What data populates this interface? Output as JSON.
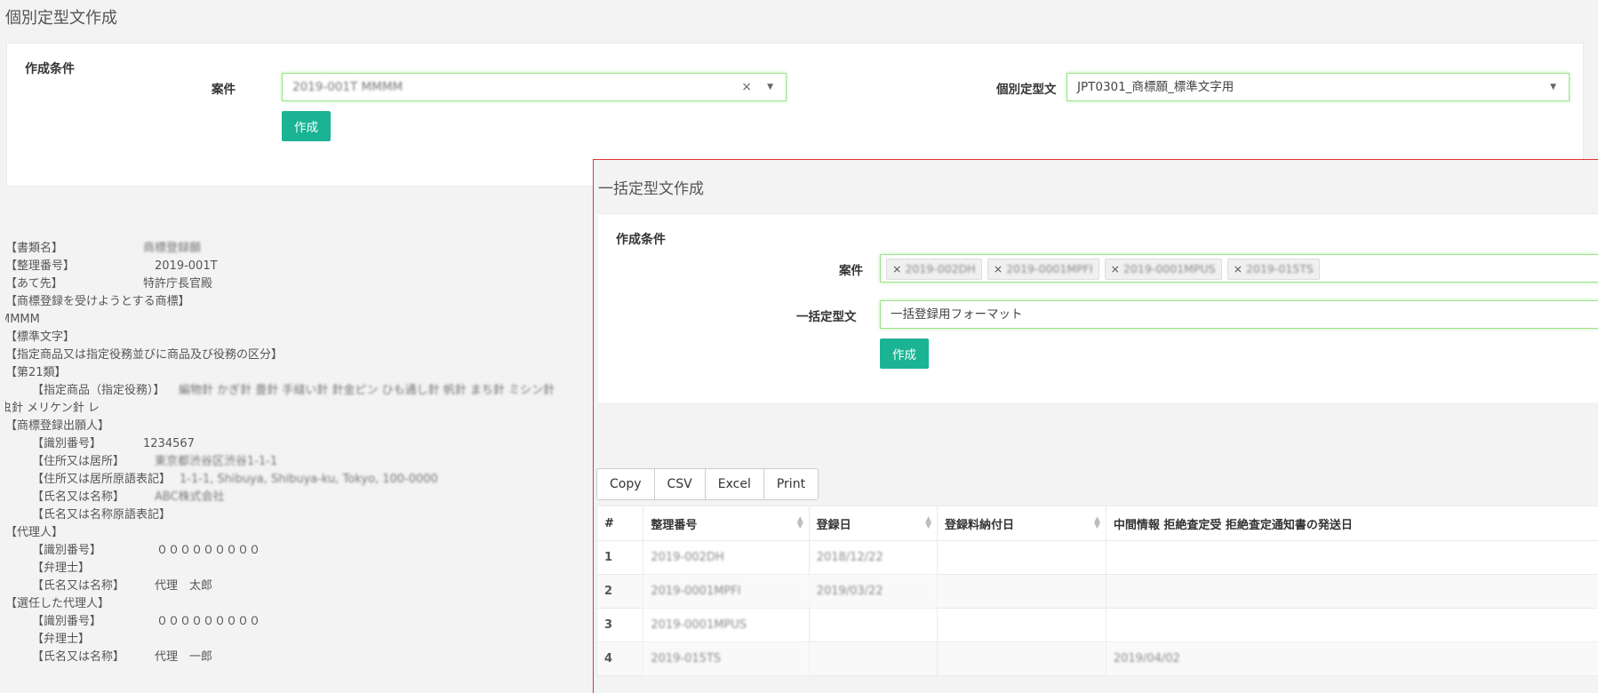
{
  "page_title": "個別定型文作成",
  "top_panel": {
    "heading": "作成条件",
    "case_label": "案件",
    "case_value": "2019-001T MMMM",
    "case_clear": "×",
    "case_arrow": "▼",
    "template_label": "個別定型文",
    "template_value": "JPT0301_商標願_標準文字用",
    "template_arrow": "▼",
    "create_button": "作成"
  },
  "document_lines": [
    {
      "key": "【書類名】",
      "val": "商標登録願",
      "blur": true,
      "indent": 0,
      "valx": 155
    },
    {
      "key": "【整理番号】",
      "val": "2019-001T",
      "blur": false,
      "indent": 0,
      "valx": 168
    },
    {
      "key": "【あて先】",
      "val": "特許庁長官殿",
      "blur": false,
      "indent": 0,
      "valx": 155
    },
    {
      "key": "【商標登録を受けようとする商標】",
      "val": "",
      "blur": false,
      "indent": 0,
      "valx": 0
    },
    {
      "key": "MMMM",
      "val": "",
      "blur": false,
      "indent": -6,
      "valx": 0
    },
    {
      "key": "【標準文字】",
      "val": "",
      "blur": false,
      "indent": 0,
      "valx": 0
    },
    {
      "key": "【指定商品又は指定役務並びに商品及び役務の区分】",
      "val": "",
      "blur": false,
      "indent": 0,
      "valx": 0
    },
    {
      "key": "【第21類】",
      "val": "",
      "blur": false,
      "indent": 0,
      "valx": 0
    },
    {
      "key": "【指定商品（指定役務）】",
      "val": "編物針 かぎ針 畳針 手縫い針 針金ピン ひも通し針 帆針 まち針 ミシン針",
      "blur": true,
      "indent": 30,
      "valx": 0
    },
    {
      "key": "虫針 メリケン針 レ",
      "val": "",
      "blur": false,
      "indent": -6,
      "valx": 0
    },
    {
      "key": "【商標登録出願人】",
      "val": "",
      "blur": false,
      "indent": 0,
      "valx": 0
    },
    {
      "key": "【識別番号】",
      "val": "1234567",
      "blur": false,
      "indent": 30,
      "valx": 155
    },
    {
      "key": "【住所又は居所】",
      "val": "東京都渋谷区渋谷1-1-1",
      "blur": true,
      "indent": 30,
      "valx": 168
    },
    {
      "key": "【住所又は居所原語表記】",
      "val": "1-1-1, Shibuya, Shibuya-ku, Tokyo, 100-0000",
      "blur": true,
      "indent": 30,
      "valx": 196
    },
    {
      "key": "【氏名又は名称】",
      "val": "ABC株式会社",
      "blur": true,
      "indent": 30,
      "valx": 168
    },
    {
      "key": "【氏名又は名称原語表記】",
      "val": "",
      "blur": false,
      "indent": 30,
      "valx": 0
    },
    {
      "key": "【代理人】",
      "val": "",
      "blur": false,
      "indent": 0,
      "valx": 0
    },
    {
      "key": "【識別番号】",
      "val": "０００００００００",
      "blur": false,
      "indent": 30,
      "valx": 170
    },
    {
      "key": "【弁理士】",
      "val": "",
      "blur": false,
      "indent": 30,
      "valx": 0
    },
    {
      "key": "【氏名又は名称】",
      "val": "代理　太郎",
      "blur": false,
      "indent": 30,
      "valx": 168
    },
    {
      "key": "【選任した代理人】",
      "val": "",
      "blur": false,
      "indent": 0,
      "valx": 0
    },
    {
      "key": "【識別番号】",
      "val": "０００００００００",
      "blur": false,
      "indent": 30,
      "valx": 170
    },
    {
      "key": "【弁理士】",
      "val": "",
      "blur": false,
      "indent": 30,
      "valx": 0
    },
    {
      "key": "【氏名又は名称】",
      "val": "代理　一郎",
      "blur": false,
      "indent": 30,
      "valx": 168
    }
  ],
  "bulk": {
    "title": "一括定型文作成",
    "heading": "作成条件",
    "case_label": "案件",
    "tags": [
      "2019-002DH",
      "2019-0001MPFI",
      "2019-0001MPUS",
      "2019-015TS"
    ],
    "tag_remove": "×",
    "template_label": "一括定型文",
    "template_value": "一括登録用フォーマット",
    "create_button": "作成",
    "toolbar": [
      "Copy",
      "CSV",
      "Excel",
      "Print"
    ],
    "columns": [
      "#",
      "整理番号",
      "登録日",
      "登録料納付日",
      "中間情報 拒絶査定受 拒絶査定通知書の発送日"
    ],
    "sort_glyph": "▲▼",
    "rows": [
      {
        "num": "1",
        "ref": "2019-002DH",
        "reg": "2018/12/22",
        "pay": "",
        "mid": ""
      },
      {
        "num": "2",
        "ref": "2019-0001MPFI",
        "reg": "2019/03/22",
        "pay": "",
        "mid": ""
      },
      {
        "num": "3",
        "ref": "2019-0001MPUS",
        "reg": "",
        "pay": "",
        "mid": ""
      },
      {
        "num": "4",
        "ref": "2019-015TS",
        "reg": "",
        "pay": "",
        "mid": "2019/04/02"
      }
    ]
  }
}
